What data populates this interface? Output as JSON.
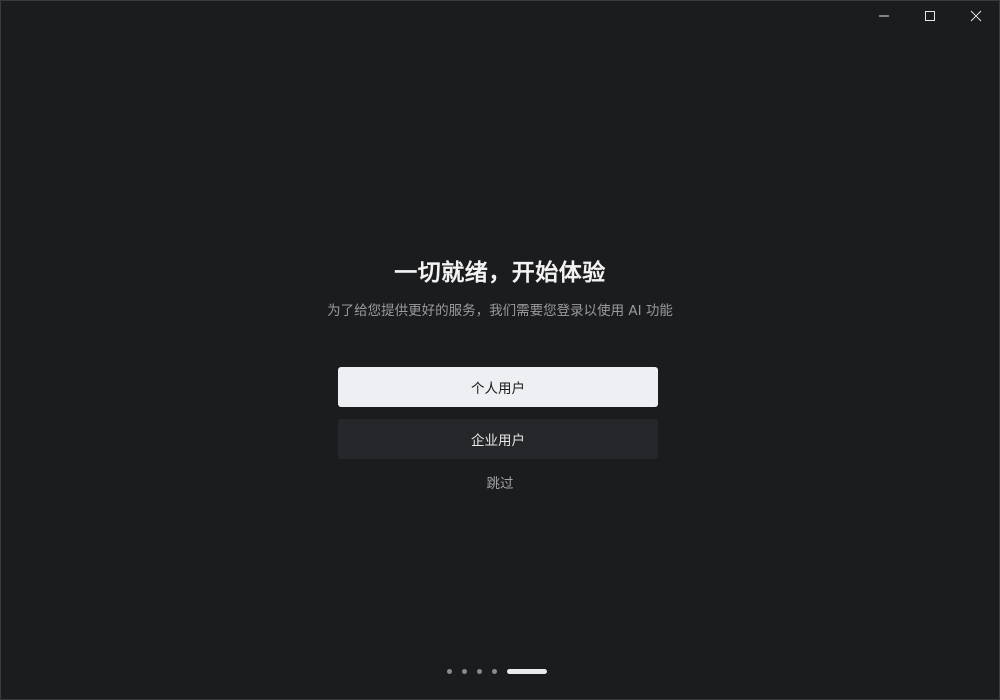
{
  "window": {
    "controls": {
      "minimize": "minimize-icon",
      "maximize": "maximize-icon",
      "close": "close-icon"
    }
  },
  "onboarding": {
    "title": "一切就绪，开始体验",
    "subtitle": "为了给您提供更好的服务，我们需要您登录以使用 AI 功能",
    "personal_button": "个人用户",
    "enterprise_button": "企业用户",
    "skip_link": "跳过"
  },
  "pager": {
    "total_pages": 5,
    "current_page": 5
  },
  "colors": {
    "background": "#1b1c1e",
    "primary_button": "#eeeff2",
    "secondary_button": "#26272a",
    "muted_text": "#9a9a9e"
  }
}
